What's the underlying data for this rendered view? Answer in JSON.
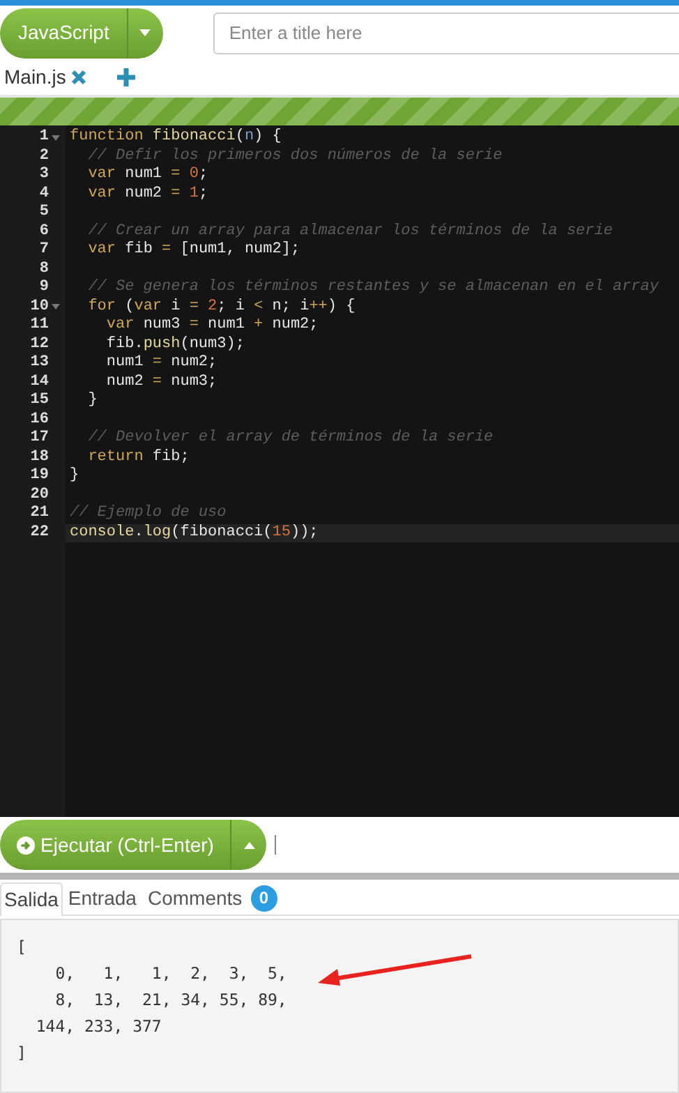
{
  "language_button": {
    "label": "JavaScript"
  },
  "title_field": {
    "placeholder": "Enter a title here"
  },
  "file_tabs": [
    {
      "label": "Main.js",
      "selected": true
    }
  ],
  "editor": {
    "lines": [
      {
        "number": "1",
        "fold": true,
        "active": false,
        "tokens": [
          {
            "kind": "kw",
            "text": "function"
          },
          {
            "kind": "fn",
            "text": " fibonacci"
          },
          {
            "kind": "plain",
            "text": "("
          },
          {
            "kind": "param",
            "text": "n"
          },
          {
            "kind": "plain",
            "text": ") {"
          }
        ]
      },
      {
        "number": "2",
        "fold": false,
        "active": false,
        "tokens": [
          {
            "kind": "comment",
            "text": "  // Defir los primeros dos números de la serie"
          }
        ]
      },
      {
        "number": "3",
        "fold": false,
        "active": false,
        "tokens": [
          {
            "kind": "kw",
            "text": "  var"
          },
          {
            "kind": "plain",
            "text": " num1 "
          },
          {
            "kind": "op",
            "text": "="
          },
          {
            "kind": "num",
            "text": " 0"
          },
          {
            "kind": "plain",
            "text": ";"
          }
        ]
      },
      {
        "number": "4",
        "fold": false,
        "active": false,
        "tokens": [
          {
            "kind": "kw",
            "text": "  var"
          },
          {
            "kind": "plain",
            "text": " num2 "
          },
          {
            "kind": "op",
            "text": "="
          },
          {
            "kind": "num",
            "text": " 1"
          },
          {
            "kind": "plain",
            "text": ";"
          }
        ]
      },
      {
        "number": "5",
        "fold": false,
        "active": false
      },
      {
        "number": "6",
        "fold": false,
        "active": false,
        "tokens": [
          {
            "kind": "comment",
            "text": "  // Crear un array para almacenar los términos de la serie"
          }
        ]
      },
      {
        "number": "7",
        "fold": false,
        "active": false,
        "tokens": [
          {
            "kind": "kw",
            "text": "  var"
          },
          {
            "kind": "plain",
            "text": " fib "
          },
          {
            "kind": "op",
            "text": "="
          },
          {
            "kind": "plain",
            "text": " [num1, num2];"
          }
        ]
      },
      {
        "number": "8",
        "fold": false,
        "active": false
      },
      {
        "number": "9",
        "fold": false,
        "active": false,
        "tokens": [
          {
            "kind": "comment",
            "text": "  // Se genera los términos restantes y se almacenan en el array"
          }
        ]
      },
      {
        "number": "10",
        "fold": true,
        "active": false,
        "tokens": [
          {
            "kind": "kw",
            "text": "  for"
          },
          {
            "kind": "plain",
            "text": " ("
          },
          {
            "kind": "kw",
            "text": "var"
          },
          {
            "kind": "plain",
            "text": " i "
          },
          {
            "kind": "op",
            "text": "="
          },
          {
            "kind": "num",
            "text": " 2"
          },
          {
            "kind": "plain",
            "text": "; i "
          },
          {
            "kind": "op",
            "text": "<"
          },
          {
            "kind": "plain",
            "text": " n; i"
          },
          {
            "kind": "op",
            "text": "++"
          },
          {
            "kind": "plain",
            "text": ") {"
          }
        ]
      },
      {
        "number": "11",
        "fold": false,
        "active": false,
        "tokens": [
          {
            "kind": "kw",
            "text": "    var"
          },
          {
            "kind": "plain",
            "text": " num3 "
          },
          {
            "kind": "op",
            "text": "="
          },
          {
            "kind": "plain",
            "text": " num1 "
          },
          {
            "kind": "op",
            "text": "+"
          },
          {
            "kind": "plain",
            "text": " num2;"
          }
        ]
      },
      {
        "number": "12",
        "fold": false,
        "active": false,
        "tokens": [
          {
            "kind": "plain",
            "text": "    fib."
          },
          {
            "kind": "fn",
            "text": "push"
          },
          {
            "kind": "plain",
            "text": "(num3);"
          }
        ]
      },
      {
        "number": "13",
        "fold": false,
        "active": false,
        "tokens": [
          {
            "kind": "plain",
            "text": "    num1 "
          },
          {
            "kind": "op",
            "text": "="
          },
          {
            "kind": "plain",
            "text": " num2;"
          }
        ]
      },
      {
        "number": "14",
        "fold": false,
        "active": false,
        "tokens": [
          {
            "kind": "plain",
            "text": "    num2 "
          },
          {
            "kind": "op",
            "text": "="
          },
          {
            "kind": "plain",
            "text": " num3;"
          }
        ]
      },
      {
        "number": "15",
        "fold": false,
        "active": false,
        "tokens": [
          {
            "kind": "plain",
            "text": "  }"
          }
        ]
      },
      {
        "number": "16",
        "fold": false,
        "active": false
      },
      {
        "number": "17",
        "fold": false,
        "active": false,
        "tokens": [
          {
            "kind": "comment",
            "text": "  // Devolver el array de términos de la serie"
          }
        ]
      },
      {
        "number": "18",
        "fold": false,
        "active": false,
        "tokens": [
          {
            "kind": "kw",
            "text": "  return"
          },
          {
            "kind": "plain",
            "text": " fib;"
          }
        ]
      },
      {
        "number": "19",
        "fold": false,
        "active": false,
        "tokens": [
          {
            "kind": "plain",
            "text": "}"
          }
        ]
      },
      {
        "number": "20",
        "fold": false,
        "active": false
      },
      {
        "number": "21",
        "fold": false,
        "active": false,
        "tokens": [
          {
            "kind": "comment",
            "text": "// Ejemplo de uso"
          }
        ]
      },
      {
        "number": "22",
        "fold": false,
        "active": true,
        "tokens": [
          {
            "kind": "fn",
            "text": "console"
          },
          {
            "kind": "plain",
            "text": "."
          },
          {
            "kind": "fn",
            "text": "log"
          },
          {
            "kind": "plain",
            "text": "(fibonacci("
          },
          {
            "kind": "num",
            "text": "15"
          },
          {
            "kind": "plain",
            "text": "));"
          }
        ]
      }
    ]
  },
  "run_button": {
    "label": "Ejecutar (Ctrl-Enter)"
  },
  "output_tabs": [
    {
      "label": "Salida",
      "selected": true
    },
    {
      "label": "Entrada",
      "selected": false
    },
    {
      "label": "Comments",
      "selected": false,
      "badge": "0"
    }
  ],
  "output": {
    "lines": [
      "[",
      "    0,   1,   1,  2,  3,  5,",
      "    8,  13,  21, 34, 55, 89,",
      "  144, 233, 377",
      "]"
    ]
  }
}
